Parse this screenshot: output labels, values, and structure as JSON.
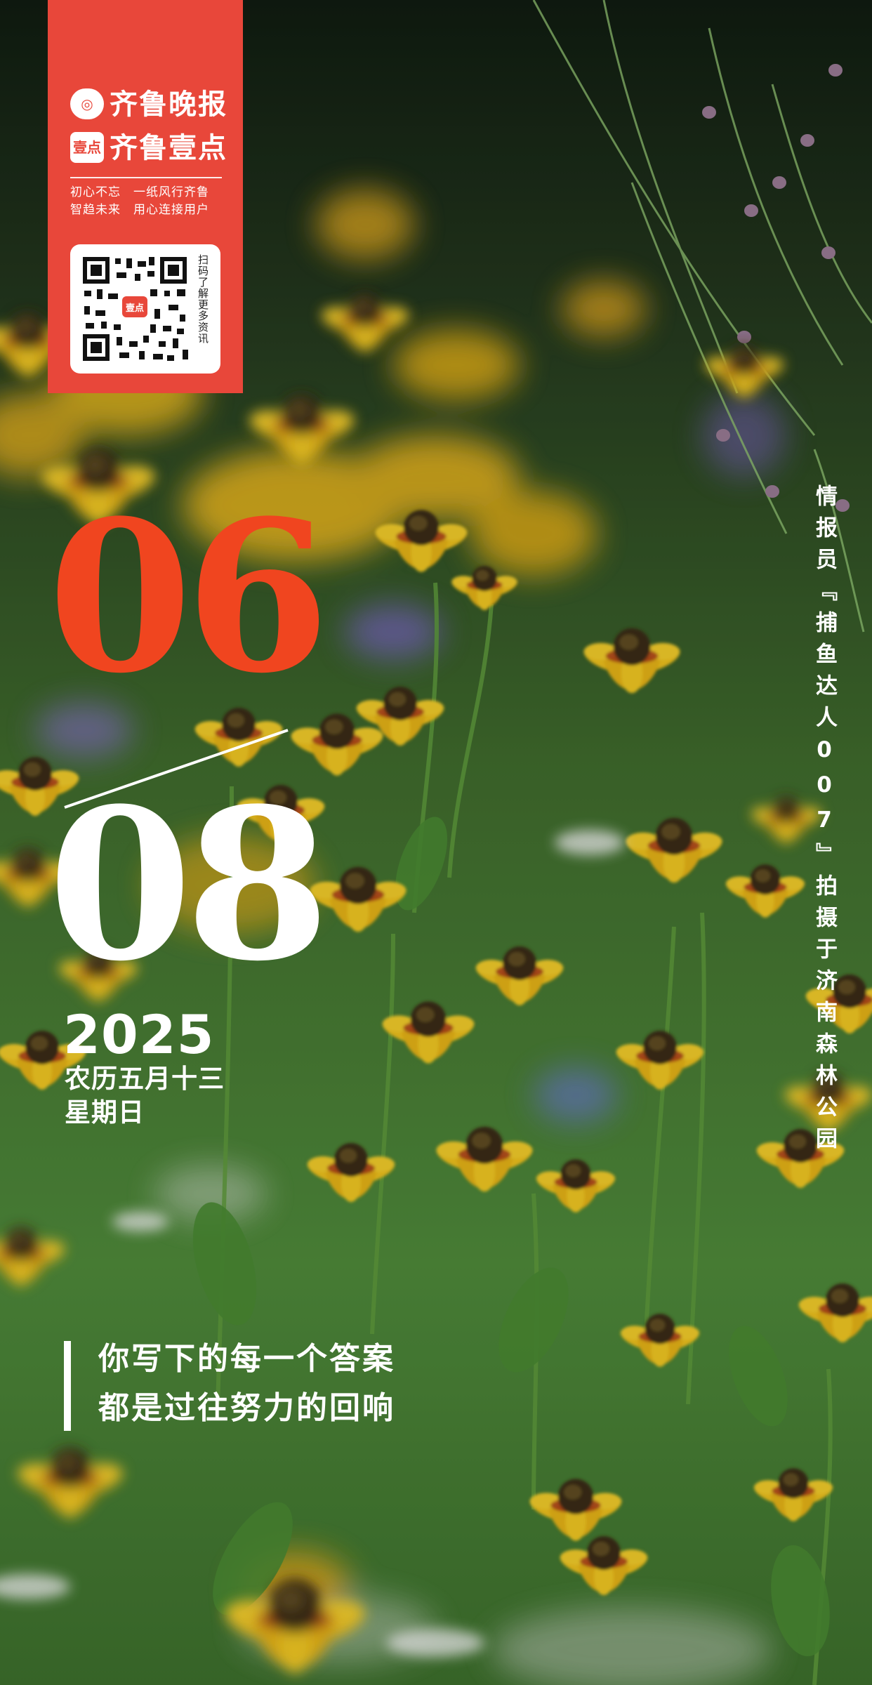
{
  "brand": {
    "newspaper_name": "齐鲁晚报",
    "app_mark": "壹点",
    "app_name": "齐鲁壹点",
    "slogan_line_1": "初心不忘　一纸风行齐鲁",
    "slogan_line_2": "智趋未来　用心连接用户",
    "qr_caption": "扫码了解更多资讯",
    "qr_center_mark": "壹点"
  },
  "date": {
    "day": "06",
    "month": "08",
    "year": "2025",
    "lunar": "农历五月十三",
    "weekday": "星期日"
  },
  "quote": {
    "line_1": "你写下的每一个答案",
    "line_2": "都是过往努力的回响"
  },
  "photo_credit": "情报员『捕鱼达人007』拍摄于济南森林公园",
  "colors": {
    "brand_red": "#e8473a",
    "day_orange": "#f0451f",
    "flower_yellow": "#f2c21a",
    "flower_center": "#3a2a12",
    "foliage_green": "#4f8a3a"
  }
}
